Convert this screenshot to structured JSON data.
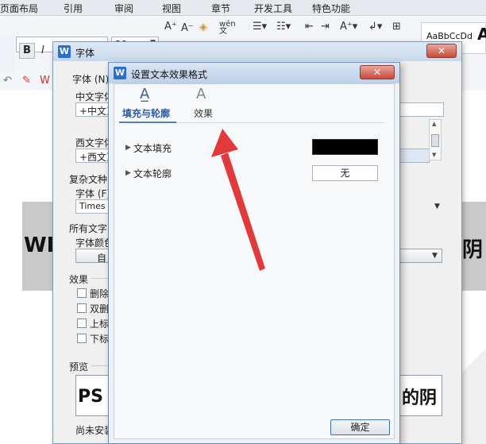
{
  "menu": [
    "页面布局",
    "引用",
    "审阅",
    "视图",
    "章节",
    "开发工具",
    "特色功能"
  ],
  "ribbon": {
    "font_size": "20",
    "style_sample": "AaBbCcDd",
    "style_big": "A",
    "bold": "B"
  },
  "document": {
    "line1_left": "WI",
    "line1_right": "阴",
    "line2_right": "的阴"
  },
  "font_dialog": {
    "title": "字体",
    "tab_font": "字体 (N)",
    "chinese_font_label": "中文字体",
    "chinese_font_value": "+中文正",
    "western_font_label": "西文字体",
    "western_font_value": "+西文正",
    "complex_label": "复杂文种",
    "complex_font_label": "字体 (F)",
    "complex_font_value": "Times",
    "all_text_label": "所有文字",
    "font_color_label": "字体颜色",
    "font_color_value": "自",
    "effects_label": "效果",
    "effects": [
      "删除",
      "双删",
      "上标",
      "下标"
    ],
    "preview_label": "预览",
    "preview_left": "PS",
    "preview_right": "的阴",
    "footer_note": "尚未安装"
  },
  "effect_dialog": {
    "title": "设置文本效果格式",
    "tabs": [
      {
        "label": "填充与轮廓",
        "active": true
      },
      {
        "label": "效果",
        "active": false
      }
    ],
    "rows": [
      {
        "label": "文本填充",
        "value": ""
      },
      {
        "label": "文本轮廓",
        "value": "无"
      }
    ],
    "ok": "确定"
  },
  "colors": {
    "fill_swatch": "#000000",
    "arrow": "#e03a3a",
    "close": "#c74a3a"
  }
}
